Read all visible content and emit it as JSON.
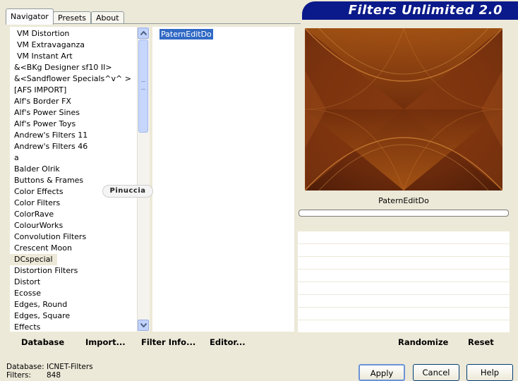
{
  "window": {
    "title": "Filters Unlimited 2.0"
  },
  "tabs": [
    {
      "label": "Navigator"
    },
    {
      "label": "Presets"
    },
    {
      "label": "About"
    }
  ],
  "categories": [
    "VM Distortion",
    "VM Extravaganza",
    "VM Instant Art",
    "&<BKg Designer sf10 II>",
    "&<Sandflower Specials^v^ >",
    "[AFS IMPORT]",
    "Alf's Border FX",
    "Alf's Power Sines",
    "Alf's Power Toys",
    "Andrew's Filters 11",
    "Andrew's Filters 46",
    "a",
    "Balder Olrik",
    "Buttons & Frames",
    "Color Effects",
    "Color Filters",
    "ColorRave",
    "ColourWorks",
    "Convolution Filters",
    "Crescent Moon",
    "DCspecial",
    "Distortion Filters",
    "Distort",
    "Ecosse",
    "Edges, Round",
    "Edges, Square",
    "Effects"
  ],
  "selected_category": "DCspecial",
  "filters": [
    "PaternEditDo"
  ],
  "preview": {
    "filter_name": "PaternEditDo"
  },
  "toolbar": {
    "database": "Database",
    "import": "Import...",
    "filter_info": "Filter Info...",
    "editor": "Editor...",
    "randomize": "Randomize",
    "reset": "Reset"
  },
  "status": {
    "database_label": "Database:",
    "database_value": "ICNET-Filters",
    "filters_label": "Filters:",
    "filters_value": "848"
  },
  "dialog": {
    "apply": "Apply",
    "cancel": "Cancel",
    "help": "Help"
  },
  "watermark": "Pinuccia",
  "colors": {
    "banner": "#0a1a8a",
    "selection": "#316ac5",
    "preview_base": "#6e2a0c"
  }
}
